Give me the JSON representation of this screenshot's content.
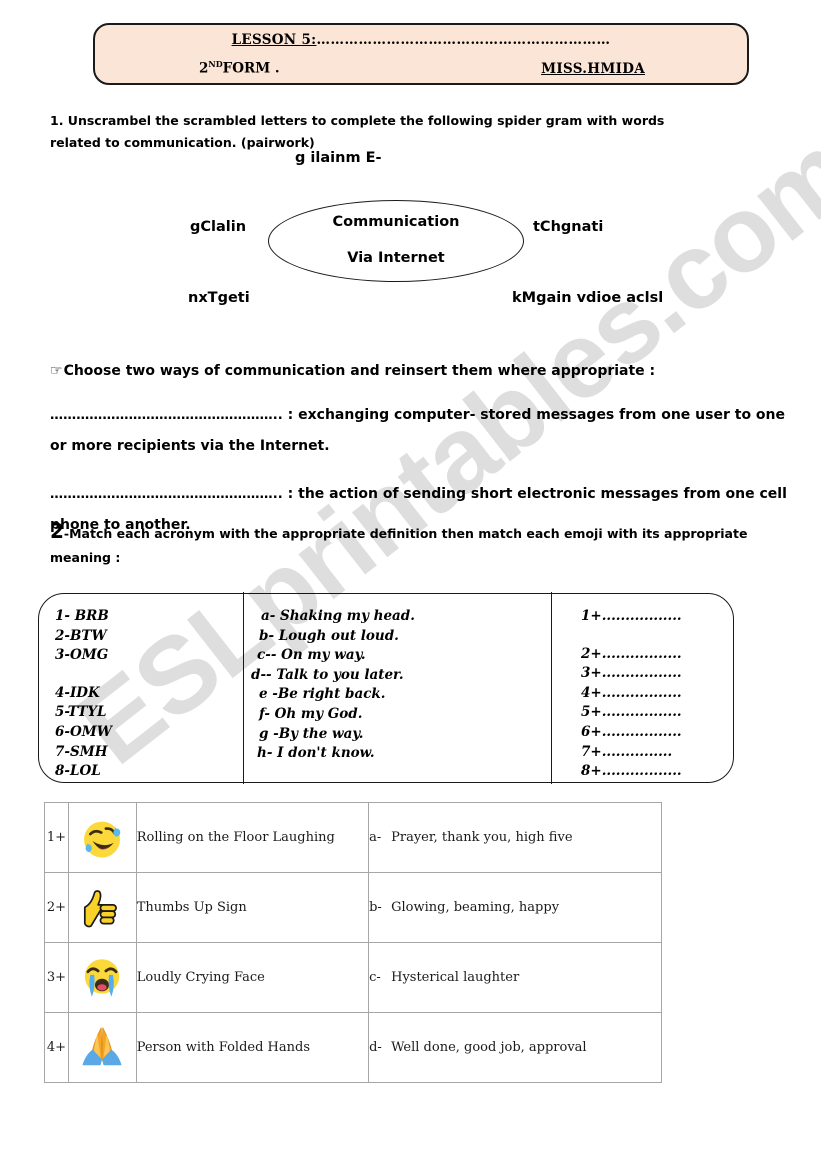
{
  "watermark": {
    "text": "ESLprintables.com"
  },
  "header": {
    "lesson_label": "LESSON 5:",
    "lesson_dots": "………………………………………………………",
    "form_label": "2",
    "form_sup": "ND",
    "form_rest": "FORM .",
    "teacher": "MISS.HMIDA",
    "bg_color": "#FBE5D6"
  },
  "exercise1": {
    "instruction": "1. Unscrambel the scrambled letters to complete the following spider gram with words related to communication. (pairwork)",
    "spidergram": {
      "center_line1": "Communication",
      "center_line2": "Via Internet",
      "top": "g ilainm E-",
      "left_upper": "gClalin",
      "right_upper": "tChgnati",
      "left_lower": "nxTgeti",
      "right_lower": "kMgain vdioe aclsl"
    },
    "choose_prompt_icon": "pointing-hand-icon",
    "choose_prompt": "Choose two ways of communication and reinsert them where appropriate :",
    "blank_dots": "……………………………………………..",
    "blank1_text": " : exchanging computer- stored messages from one user to one or more recipients via the Internet.",
    "blank2_text": " : the action of sending short electronic messages from one cell phone to another."
  },
  "exercise2": {
    "number": "2",
    "instruction": "-Match each acronym with the appropriate definition then match each emoji with its appropriate meaning :",
    "acronyms": [
      {
        "text": "1- BRB",
        "gap_before": false
      },
      {
        "text": "2-BTW",
        "gap_before": false
      },
      {
        "text": "3-OMG",
        "gap_before": false
      },
      {
        "text": "4-IDK",
        "gap_before": true
      },
      {
        "text": "5-TTYL",
        "gap_before": false
      },
      {
        "text": "6-OMW",
        "gap_before": false
      },
      {
        "text": "7-SMH",
        "gap_before": false
      },
      {
        "text": "8-LOL",
        "gap_before": false
      }
    ],
    "definitions": [
      "a- Shaking my head.",
      "b- Lough out loud.",
      "c-- On my way.",
      "d--  Talk to you later.",
      "e -Be right back.",
      "f-   Oh my God.",
      "g -By the way.",
      "h- I don't know."
    ],
    "answers": [
      {
        "text": "1+.................",
        "gap_before": false
      },
      {
        "text": "2+.................",
        "gap_before": true
      },
      {
        "text": "3+.................",
        "gap_before": false
      },
      {
        "text": "4+.................",
        "gap_before": false
      },
      {
        "text": "5+.................",
        "gap_before": false
      },
      {
        "text": "6+.................",
        "gap_before": false
      },
      {
        "text": "7+...............",
        "gap_before": false
      },
      {
        "text": "8+.................",
        "gap_before": false
      }
    ]
  },
  "emoji_table": {
    "rows": [
      {
        "number": "1+",
        "emoji_name": "rolling-on-the-floor-laughing-emoji",
        "label": "Rolling on the Floor Laughing",
        "meaning_letter": "a-",
        "meaning": "Prayer, thank you, high five"
      },
      {
        "number": "2+",
        "emoji_name": "thumbs-up-emoji",
        "label": "Thumbs Up Sign",
        "meaning_letter": "b-",
        "meaning": "Glowing, beaming, happy"
      },
      {
        "number": "3+",
        "emoji_name": "loudly-crying-face-emoji",
        "label": "Loudly  Crying Face",
        "meaning_letter": "c-",
        "meaning": "Hysterical laughter"
      },
      {
        "number": "4+",
        "emoji_name": "folded-hands-emoji",
        "label": "Person with Folded Hands",
        "meaning_letter": "d-",
        "meaning": "Well done, good job, approval"
      }
    ]
  }
}
